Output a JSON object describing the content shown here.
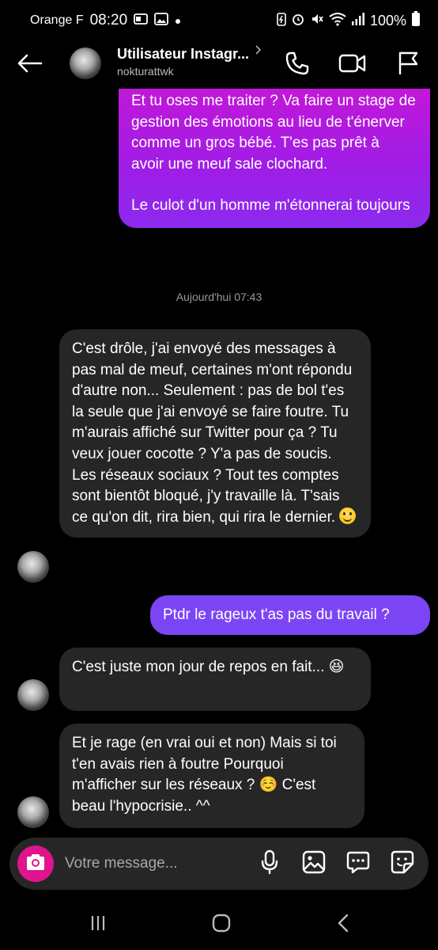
{
  "status_bar": {
    "carrier": "Orange F",
    "time": "08:20",
    "battery": "100%"
  },
  "header": {
    "name": "Utilisateur Instagr...",
    "username": "nokturattwk"
  },
  "conversation": {
    "msg1_p1": "Et tu oses me traiter ? Va faire un stage de gestion des émotions au lieu de t'énerver comme un gros bébé. T'es pas prêt à avoir une meuf sale clochard.",
    "msg1_p2": "Le culot d'un homme m'étonnerai toujours",
    "timestamp": "Aujourd'hui 07:43",
    "msg2": "C'est drôle, j'ai envoyé des messages à pas mal de meuf, certaines m'ont répondu d'autre non... Seulement : pas de bol t'es la seule que j'ai envoyé se faire foutre. Tu m'aurais affiché sur Twitter pour ça ? Tu veux jouer cocotte ? Y'a pas de soucis. Les réseaux sociaux ? Tout tes comptes sont bientôt bloqué, j'y travaille là. T'sais ce qu'on dit, rira bien, qui rira le dernier.",
    "msg3": "Ptdr le rageux t'as pas du travail ?",
    "msg4": "C'est juste mon jour de repos en fait... 😆",
    "msg5": "Et je rage (en vrai oui et non)  Mais si toi t'en avais rien à foutre Pourquoi m'afficher sur les réseaux ? ☺️ C'est beau l'hypocrisie.. ^^"
  },
  "composer": {
    "placeholder": "Votre message..."
  },
  "colors": {
    "sent_gradient_top": "#c217d8",
    "sent_gradient_bottom": "#8a2bee",
    "sent_purple": "#7c45f4",
    "received": "#262626",
    "camera_button": "#e0148c"
  },
  "icons": [
    "arrow-left-icon",
    "phone-icon",
    "video-icon",
    "flag-icon",
    "camera-icon",
    "microphone-icon",
    "image-icon",
    "chat-bubble-icon",
    "sticker-icon",
    "recents-icon",
    "home-icon",
    "back-icon"
  ]
}
